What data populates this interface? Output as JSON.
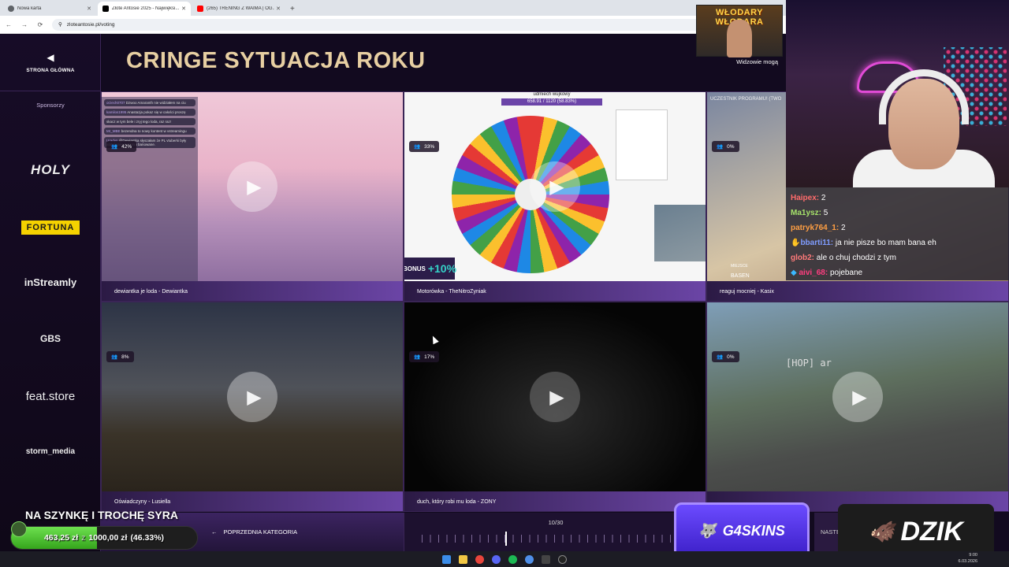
{
  "browser": {
    "tabs": [
      {
        "label": "Nowa karta",
        "color": "#5f6368"
      },
      {
        "label": "Złote Antosie 2025 - Najwięksi...",
        "color": "#000000"
      },
      {
        "label": "(265) TRENING Z WAIMA | OG...",
        "color": "#ff0000"
      }
    ],
    "new_tab": "+",
    "url": "zloteantosie.pl/voting"
  },
  "sidebar": {
    "home_label": "STRONA GŁÓWNA",
    "sponsors_label": "Sponsorzy",
    "sponsors": [
      "HOLY",
      "FORTUNA",
      "inStreamly",
      "GBS",
      "feat.store",
      "storm_media"
    ]
  },
  "category_title": "CRINGE SYTUACJA ROKU",
  "nominees": [
    {
      "caption": "dewiantka je loda - Dewiantka",
      "percent": "42%"
    },
    {
      "caption": "Motorówka - TheNitroZyniak",
      "percent": "33%"
    },
    {
      "caption": "reaguj mocniej - Kasix",
      "percent": "0%"
    },
    {
      "caption": "Oświadczyny - Lusiella",
      "percent": "8%"
    },
    {
      "caption": "duch, który robi mu loda - ZONY",
      "percent": "17%"
    },
    {
      "caption": "",
      "percent": "0%"
    }
  ],
  "wheel": {
    "title": "udmiech wujkowy",
    "counter": "658.91 / 1120 (58.83%)",
    "bonus": "+10%",
    "bonus_word": "BONUS"
  },
  "card3_overlay": {
    "top": "UCZESTNIK PROGRAMU! (TWO",
    "label1": "MIEJSCE",
    "label2": "BASEN"
  },
  "card6_overlay": "[HOP] ar",
  "stream": {
    "sign": "WŁODARY WŁODARA",
    "viewers_note": "Widzowie mogą",
    "chat": [
      {
        "name": "Haipex:",
        "text": "2",
        "color": "#ff6b6b"
      },
      {
        "name": "Ma1ysz:",
        "text": "5",
        "color": "#a6e36b"
      },
      {
        "name": "patryk764_1:",
        "text": "2",
        "color": "#ff9f43"
      },
      {
        "name": "bbarti11:",
        "text": "ja nie pisze bo mam bana eh",
        "color": "#7f9cff"
      },
      {
        "name": "glob2:",
        "text": "ale o chuj chodzi z tym",
        "color": "#ff7a7a"
      },
      {
        "name": "aivi_68:",
        "text": "pojebane",
        "color": "#ff3d7f"
      }
    ]
  },
  "controls": {
    "prev_category": "POPRZEDNIA KATEGORIA",
    "page": "10/30",
    "next_category": "NASTĘ"
  },
  "donation": {
    "title": "NA SZYNKĘ I TROCHĘ SYRA",
    "current": "463,25 zł",
    "sep": "z",
    "goal": "1000,00 zł",
    "percent_text": "(46.33%)",
    "fraction": 0.4633
  },
  "sponsor_overlays": {
    "g4": "G4SKINS",
    "dzik": "DZIK"
  },
  "taskbar": {
    "time": "9:00",
    "date": "6.03.2026"
  }
}
